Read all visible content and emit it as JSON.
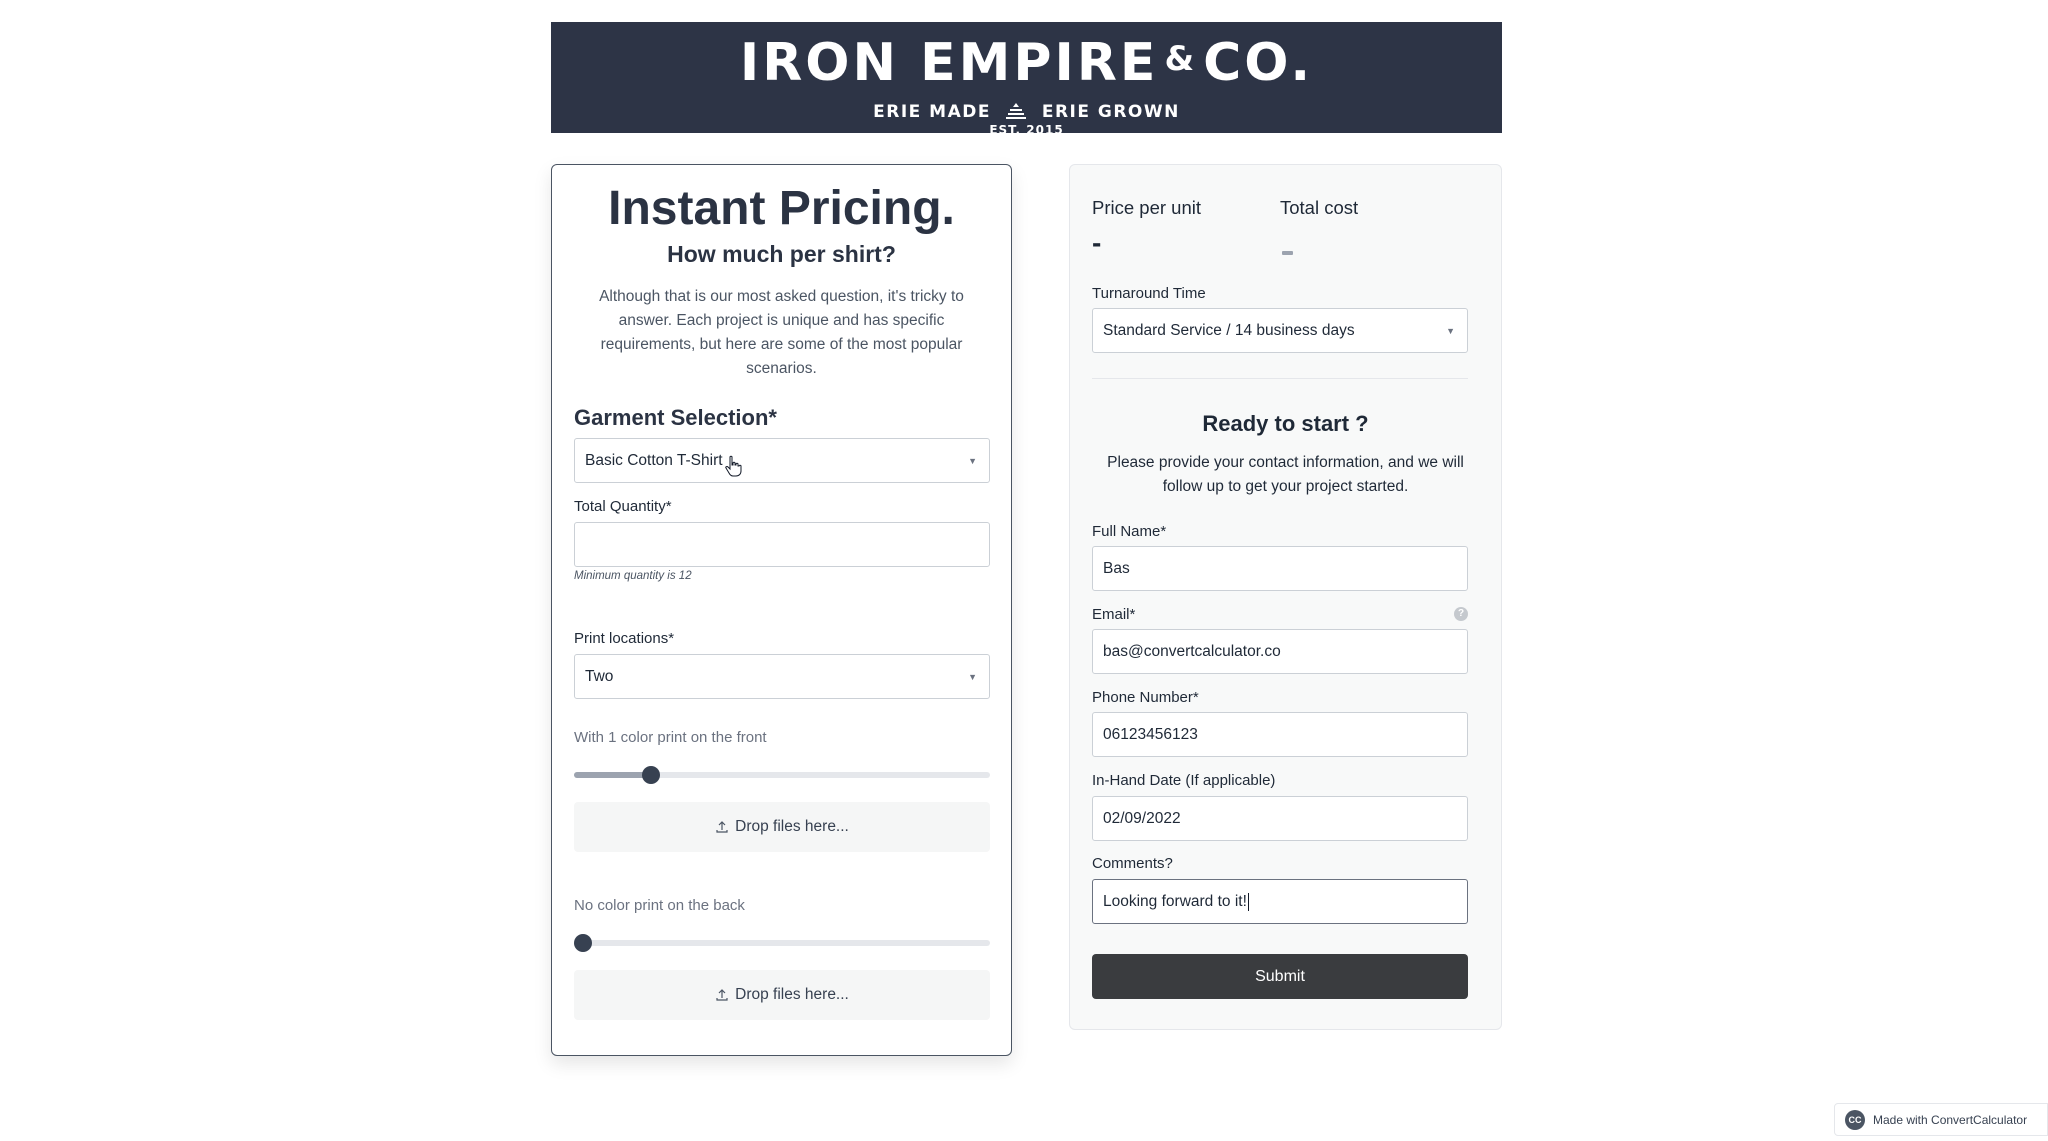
{
  "brand": {
    "name_part1": "IRON EMPIRE",
    "ampersand": "&",
    "name_part2": "CO.",
    "tagline_left": "ERIE MADE",
    "tagline_right": "ERIE GROWN",
    "established": "EST. 2015"
  },
  "pricing_card": {
    "title": "Instant Pricing.",
    "subtitle": "How much per shirt?",
    "description": "Although that is our most asked question, it's tricky to answer. Each project is unique and has specific requirements, but here are some of the most popular scenarios.",
    "garment_section_title": "Garment Selection*",
    "garment_selected": "Basic Cotton T-Shirt",
    "quantity_label": "Total Quantity*",
    "quantity_value": "",
    "quantity_hint": "Minimum quantity is 12",
    "print_locations_label": "Print locations*",
    "print_locations_selected": "Two",
    "front_slider_label": "With 1 color print on the front",
    "front_slider_fraction": 0.185,
    "back_slider_label": "No color print on the back",
    "back_slider_fraction": 0.0,
    "dropzone_label": "Drop files here..."
  },
  "summary_card": {
    "price_per_unit_label": "Price per unit",
    "price_per_unit_value": "-",
    "total_cost_label": "Total cost",
    "turnaround_label": "Turnaround Time",
    "turnaround_selected": "Standard Service / 14 business days",
    "ready_title": "Ready to start ?",
    "ready_description": "Please provide your contact information, and we will follow up to get your project started.",
    "full_name_label": "Full Name*",
    "full_name_value": "Bas",
    "email_label": "Email*",
    "email_value": "bas@convertcalculator.co",
    "phone_label": "Phone Number*",
    "phone_value": "06123456123",
    "in_hand_label": "In-Hand Date (If applicable)",
    "in_hand_value": "02/09/2022",
    "comments_label": "Comments?",
    "comments_value": "Looking forward to it!",
    "submit_label": "Submit"
  },
  "footer_badge": {
    "icon_text": "CC",
    "label": "Made with ConvertCalculator"
  },
  "colors": {
    "banner_bg": "#2d3446",
    "submit_bg": "#3a3c3f",
    "card_right_bg": "#f8f9f9"
  }
}
